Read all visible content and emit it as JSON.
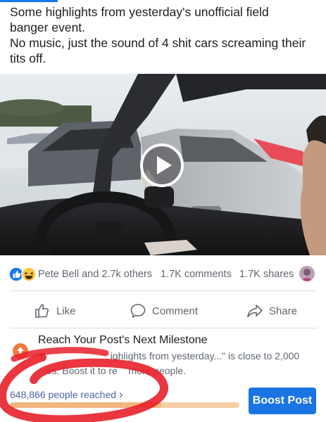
{
  "post": {
    "text_lines": [
      "Some highlights from yesterday's unofficial field",
      "banger event.",
      "No music, just the sound of 4 shit cars screaming their",
      "tits off."
    ]
  },
  "video": {
    "play_icon": "play-icon"
  },
  "engagement": {
    "reaction_icons": [
      "like-icon",
      "haha-icon"
    ],
    "reactors": "Pete Bell and 2.7k others",
    "comments": "1.7K comments",
    "shares": "1.7K shares"
  },
  "actions": {
    "like": "Like",
    "comment": "Comment",
    "share": "Share"
  },
  "milestone": {
    "title": "Reach Your Post's Next Milestone",
    "body_line1": "Y                        ighlights from yesterday...\" is close to 2,000",
    "body_line2": "   es. Boost it to re    more people.",
    "reached": "648,866 people reached",
    "reached_chevron": "›",
    "progress": 0.66,
    "boost_label": "Boost Post"
  },
  "colors": {
    "accent": "#1b74e4",
    "milestone": "#f5793b",
    "scribble": "#e8202a"
  }
}
